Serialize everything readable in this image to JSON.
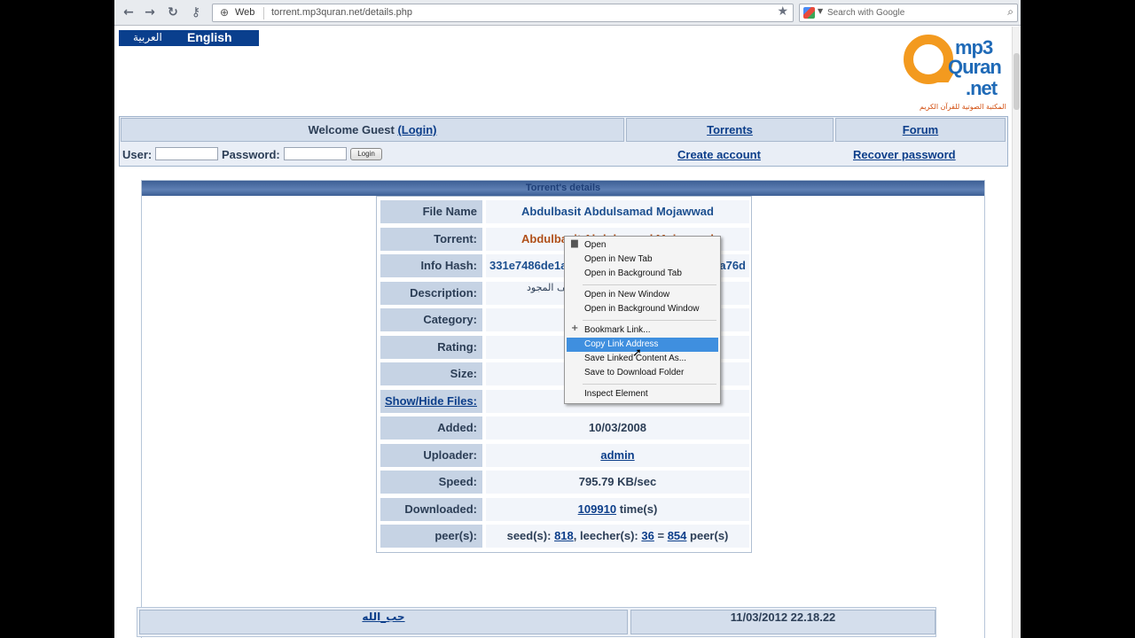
{
  "browser": {
    "back_icon": "←",
    "forward_icon": "→",
    "reload_icon": "↻",
    "key_icon": "⚷",
    "url_scheme": "Web",
    "url": "torrent.mp3quran.net/details.php",
    "search_placeholder": "Search with Google"
  },
  "lang": {
    "arabic": "العربية",
    "english": "English"
  },
  "logo": {
    "line1": "mp3",
    "line2": "Quran",
    "line3": ".net",
    "tagline": "المكتبة الصوتية للقرآن الكريم"
  },
  "header": {
    "welcome": "Welcome Guest",
    "login_link": "(Login)",
    "torrents": "Torrents",
    "forum": "Forum",
    "user_label": "User:",
    "password_label": "Password:",
    "login_button": "Login",
    "create_account": "Create account",
    "recover_password": "Recover password"
  },
  "panel_title": "Torrent's details",
  "details": [
    {
      "key": "File Name",
      "value": "Abdulbasit Abdulsamad Mojawwad"
    },
    {
      "key": "Torrent:",
      "value": "Abdulbasit Abdulsamad Mojawwad"
    },
    {
      "key": "Info Hash:",
      "value": "331e7486de1a",
      "value_tail": "a76d"
    },
    {
      "key": "Description:",
      "value": "المصحف المجود"
    },
    {
      "key": "Category:",
      "value": ""
    },
    {
      "key": "Rating:",
      "value": ""
    },
    {
      "key": "Size:",
      "value": ""
    },
    {
      "key": "Show/Hide Files:",
      "value": ""
    },
    {
      "key": "Added:",
      "value": "10/03/2008"
    },
    {
      "key": "Uploader:",
      "value": "admin"
    },
    {
      "key": "Speed:",
      "value": "795.79 KB/sec"
    },
    {
      "key": "Downloaded:",
      "value": "109910",
      "value_suffix": "time(s)"
    },
    {
      "key": "peer(s):",
      "seed_label": "seed(s):",
      "seeds": "818",
      "leech_label": ", leecher(s):",
      "leechers": "36",
      "equals": "=",
      "peers": "854",
      "peers_suffix": "peer(s)"
    }
  ],
  "comment": {
    "author": "حب_الله",
    "date": "11/03/2012 22.18.22"
  },
  "context_menu": {
    "items": [
      {
        "label": "Open"
      },
      {
        "label": "Open in New Tab"
      },
      {
        "label": "Open in Background Tab"
      },
      {
        "label": "Open in New Window"
      },
      {
        "label": "Open in Background Window"
      },
      {
        "label": "Bookmark Link..."
      },
      {
        "label": "Copy Link Address"
      },
      {
        "label": "Save Linked Content As..."
      },
      {
        "label": "Save to Download Folder"
      },
      {
        "label": "Inspect Element"
      }
    ],
    "highlighted": "Copy Link Address"
  }
}
